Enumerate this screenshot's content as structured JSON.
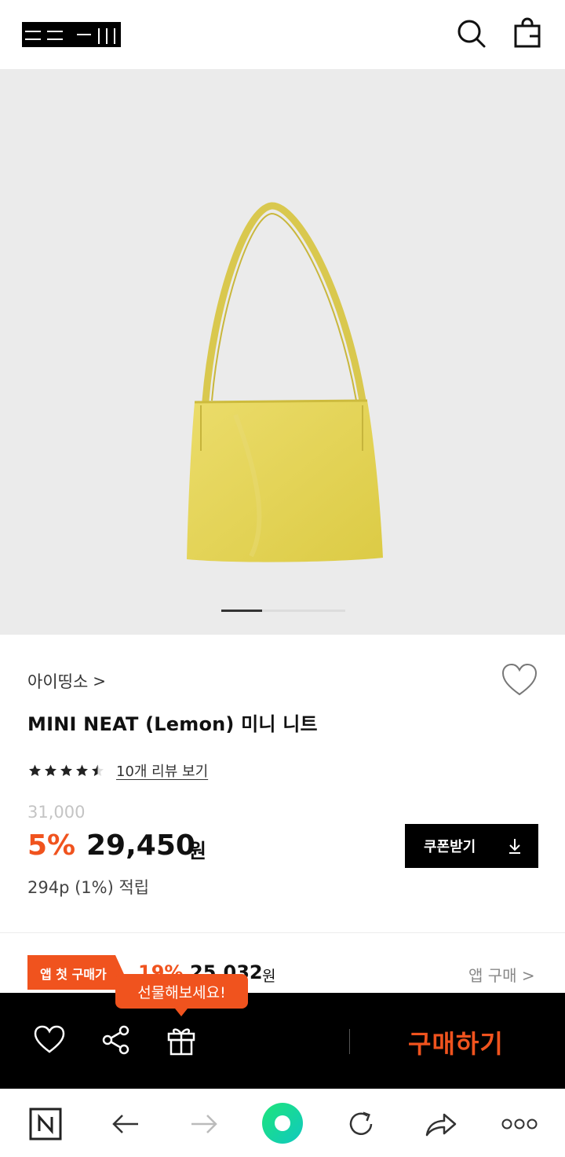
{
  "header": {
    "logo_text": "ZIZI ZIII",
    "search_icon": "search-icon",
    "bag_icon": "shopping-bag-icon"
  },
  "gallery": {
    "image_description_icon": "product-photo",
    "bag_color": "#e6d85a",
    "background_color": "#ebebeb",
    "current_slide": 1,
    "total_slides": 3
  },
  "product": {
    "brand": "아이띵소",
    "brand_chevron": ">",
    "title": "MINI NEAT (Lemon) 미니 니트",
    "rating": 4.5,
    "rating_max": 5,
    "review_link": "10개 리뷰 보기",
    "original_price": "31,000",
    "discount": "5%",
    "price": "29,450",
    "currency": "원",
    "points": "294p (1%) 적립",
    "coupon_label": "쿠폰받기"
  },
  "app_offer": {
    "badge": "앱 첫 구매가",
    "discount": "19%",
    "price": "25,032",
    "currency": "원",
    "link": "앱 구매 >"
  },
  "tooltip": {
    "text": "선물해보세요!"
  },
  "action_bar": {
    "buy_label": "구매하기",
    "accent_color": "#f0531e"
  },
  "browser_bar": {
    "home_label": "N"
  }
}
